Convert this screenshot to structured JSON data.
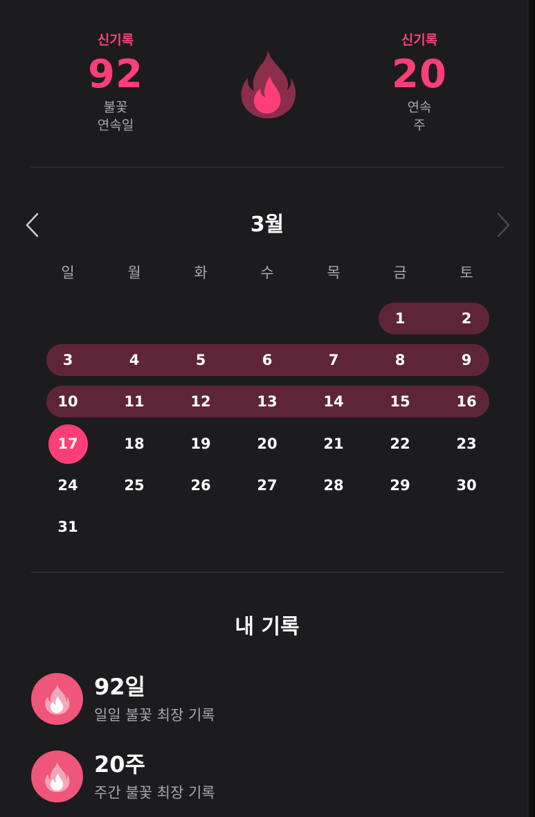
{
  "stats": {
    "left": {
      "badge": "신기록",
      "value": "92",
      "label_line1": "불꽃",
      "label_line2": "연속일"
    },
    "right": {
      "badge": "신기록",
      "value": "20",
      "label_line1": "연속",
      "label_line2": "주"
    }
  },
  "hero_icon": "fire-icon",
  "calendar": {
    "month_title": "3월",
    "prev_icon": "chevron-left-icon",
    "next_icon": "chevron-right-icon",
    "weekdays": [
      "일",
      "월",
      "화",
      "수",
      "목",
      "금",
      "토"
    ],
    "days": [
      "1",
      "2",
      "3",
      "4",
      "5",
      "6",
      "7",
      "8",
      "9",
      "10",
      "11",
      "12",
      "13",
      "14",
      "15",
      "16",
      "17",
      "18",
      "19",
      "20",
      "21",
      "22",
      "23",
      "24",
      "25",
      "26",
      "27",
      "28",
      "29",
      "30",
      "31"
    ],
    "today": "17",
    "streak_range": "1-16"
  },
  "records": {
    "title": "내 기록",
    "items": [
      {
        "icon": "fire-icon",
        "value": "92일",
        "desc": "일일 불꽃 최장 기록"
      },
      {
        "icon": "fire-icon",
        "value": "20주",
        "desc": "주간 불꽃 최장 기록"
      }
    ]
  },
  "colors": {
    "background": "#1c1b1e",
    "accent": "#ff3e7a",
    "streak_band": "#5e2538",
    "flame_outer": "#8a2e4c",
    "record_icon_bg": "#f0557a",
    "secondary_text": "#a9a8ad"
  }
}
